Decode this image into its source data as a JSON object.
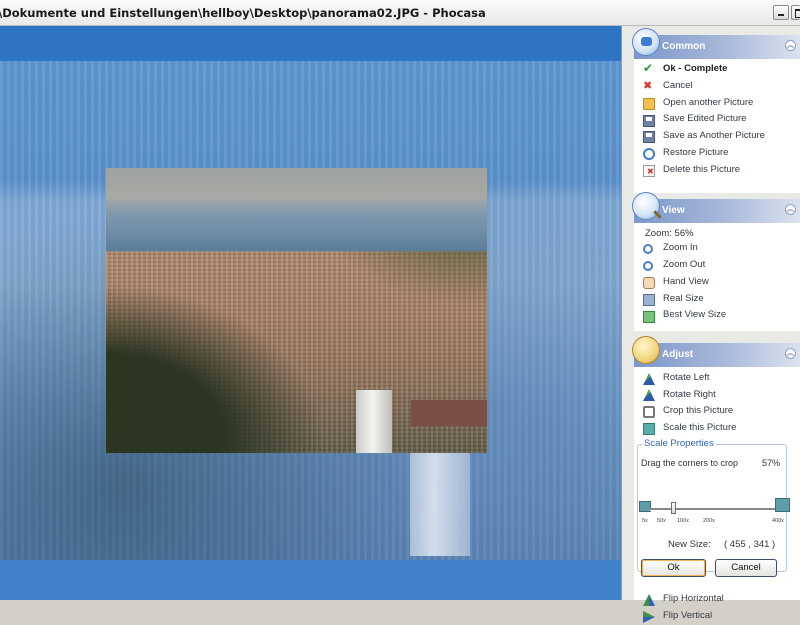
{
  "window": {
    "title": "\\Dokumente und Einstellungen\\hellboy\\Desktop\\panorama02.JPG - Phocasa"
  },
  "common": {
    "title": "Common",
    "items": [
      {
        "label": "Ok - Complete",
        "icon": "checkmark-icon"
      },
      {
        "label": "Cancel",
        "icon": "red-x-icon"
      },
      {
        "label": "Open another Picture",
        "icon": "folder-open-icon"
      },
      {
        "label": "Save Edited Picture",
        "icon": "floppy-disk-icon"
      },
      {
        "label": "Save as Another Picture",
        "icon": "floppy-disk-icon"
      },
      {
        "label": "Restore Picture",
        "icon": "restore-icon"
      },
      {
        "label": "Delete this Picture",
        "icon": "delete-icon"
      }
    ]
  },
  "view": {
    "title": "View",
    "zoom_label": "Zoom: 56%",
    "items": [
      {
        "label": "Zoom In",
        "icon": "zoom-in-icon"
      },
      {
        "label": "Zoom Out",
        "icon": "zoom-out-icon"
      },
      {
        "label": "Hand View",
        "icon": "hand-icon"
      },
      {
        "label": "Real Size",
        "icon": "real-size-icon"
      },
      {
        "label": "Best View Size",
        "icon": "best-view-icon"
      }
    ]
  },
  "adjust": {
    "title": "Adjust",
    "items": [
      {
        "label": "Rotate Left",
        "icon": "rotate-left-icon"
      },
      {
        "label": "Rotate Right",
        "icon": "rotate-right-icon"
      },
      {
        "label": "Crop this Picture",
        "icon": "crop-icon"
      },
      {
        "label": "Scale this Picture",
        "icon": "scale-icon"
      }
    ],
    "scale": {
      "title": "Scale Properties",
      "instruction": "Drag the corners to crop",
      "percent": "57%",
      "slider_value": 0.57,
      "ticks": [
        "5x",
        "50x",
        "100x",
        "200x",
        "400x"
      ],
      "new_size_label": "New Size:",
      "new_size_value": "( 455 , 341 )",
      "ok_label": "Ok",
      "cancel_label": "Cancel"
    },
    "flip_items": [
      {
        "label": "Flip Horizontal",
        "icon": "flip-horizontal-icon"
      },
      {
        "label": "Flip Vertical",
        "icon": "flip-vertical-icon"
      }
    ]
  },
  "colors": {
    "viewer_background": "#3f82c9",
    "panel_header": "#7b97c9",
    "link_text": "#333a45",
    "accent_blue": "#2b63b6"
  }
}
